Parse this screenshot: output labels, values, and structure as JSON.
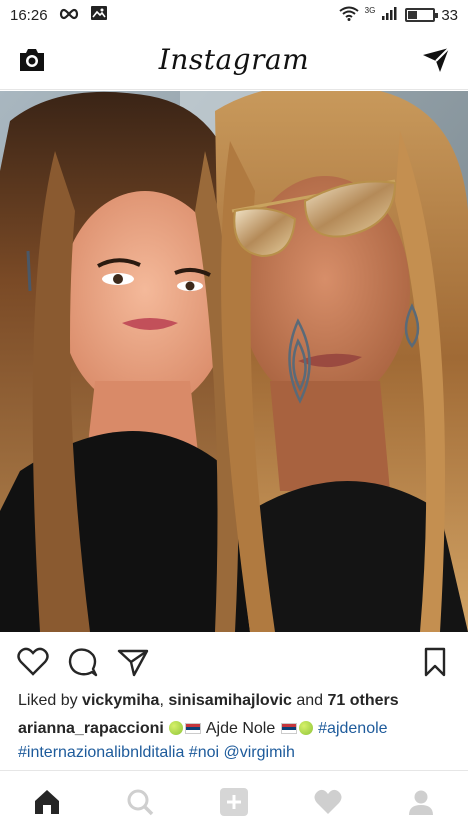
{
  "status_bar": {
    "time": "16:26",
    "network": "3G",
    "battery_percent": "33",
    "battery_level": 0.33,
    "icons": [
      "infinity-icon",
      "image-notification-icon",
      "wifi-icon",
      "signal-icon",
      "battery-icon"
    ]
  },
  "header": {
    "logo": "Instagram",
    "left_icon": "camera-icon",
    "right_icon": "direct-message-icon"
  },
  "post": {
    "photo_icon": "post-photo",
    "actions": {
      "icons": [
        "heart-icon",
        "comment-icon",
        "share-icon",
        "bookmark-icon"
      ]
    },
    "likes": {
      "prefix": "Liked by ",
      "user1": "vickymiha",
      "separator": ", ",
      "user2": "sinisamihajlovic",
      "middle": " and ",
      "others": "71 others"
    },
    "caption": {
      "username": "arianna_rapaccioni",
      "text": " Ajde Nole ",
      "hashtag1": "#ajdenole",
      "hashtag2": "#internazionalibnlditalia",
      "hashtag3": "#noi",
      "mention": "@virgimih"
    }
  },
  "bottom_nav": {
    "items": [
      "home-icon",
      "search-icon",
      "add-post-icon",
      "activity-heart-icon",
      "profile-icon"
    ]
  },
  "colors": {
    "link": "#1e5b9b",
    "text": "#262626",
    "nav_active": "#262626",
    "nav_inactive": "#cfcfcf"
  }
}
